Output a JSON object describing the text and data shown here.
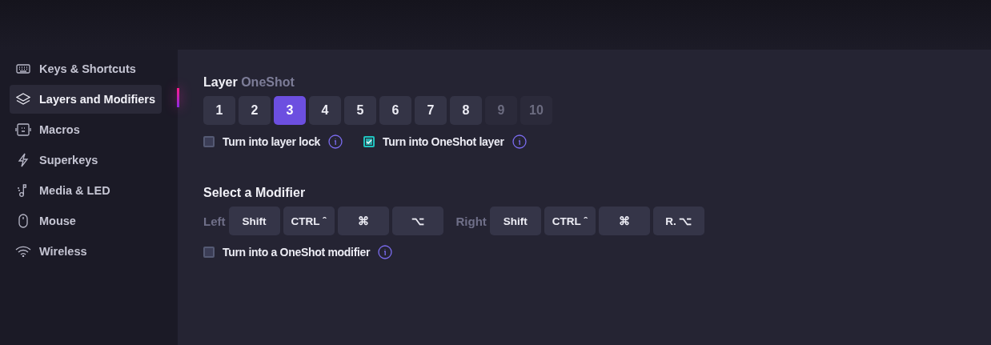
{
  "sidebar": {
    "items": [
      {
        "label": "Keys & Shortcuts",
        "kind": "keyboard",
        "selected": false
      },
      {
        "label": "Layers and Modifiers",
        "kind": "layers",
        "selected": true
      },
      {
        "label": "Macros",
        "kind": "macros",
        "selected": false
      },
      {
        "label": "Superkeys",
        "kind": "bolt",
        "selected": false
      },
      {
        "label": "Media & LED",
        "kind": "media",
        "selected": false
      },
      {
        "label": "Mouse",
        "kind": "mouse",
        "selected": false
      },
      {
        "label": "Wireless",
        "kind": "wifi",
        "selected": false
      }
    ]
  },
  "layer": {
    "title": "Layer",
    "subtitle": "OneShot",
    "buttons": [
      {
        "label": "1",
        "selected": false,
        "disabled": false
      },
      {
        "label": "2",
        "selected": false,
        "disabled": false
      },
      {
        "label": "3",
        "selected": true,
        "disabled": false
      },
      {
        "label": "4",
        "selected": false,
        "disabled": false
      },
      {
        "label": "5",
        "selected": false,
        "disabled": false
      },
      {
        "label": "6",
        "selected": false,
        "disabled": false
      },
      {
        "label": "7",
        "selected": false,
        "disabled": false
      },
      {
        "label": "8",
        "selected": false,
        "disabled": false
      },
      {
        "label": "9",
        "selected": false,
        "disabled": true
      },
      {
        "label": "10",
        "selected": false,
        "disabled": true
      }
    ],
    "options": [
      {
        "label": "Turn into layer lock",
        "checked": false
      },
      {
        "label": "Turn into OneShot layer",
        "checked": true
      }
    ]
  },
  "modifier": {
    "title": "Select a Modifier",
    "groups": [
      {
        "label": "Left",
        "keys": [
          {
            "label": "Shift",
            "selected": false
          },
          {
            "label": "CTRL ˆ",
            "selected": false
          },
          {
            "label": "⌘",
            "selected": false
          },
          {
            "label": "⌥",
            "selected": false
          }
        ]
      },
      {
        "label": "Right",
        "keys": [
          {
            "label": "Shift",
            "selected": false
          },
          {
            "label": "CTRL ˆ",
            "selected": false
          },
          {
            "label": "⌘",
            "selected": false
          },
          {
            "label": "R. ⌥",
            "selected": false
          }
        ]
      }
    ],
    "options": [
      {
        "label": "Turn into a OneShot modifier",
        "checked": false
      }
    ]
  }
}
